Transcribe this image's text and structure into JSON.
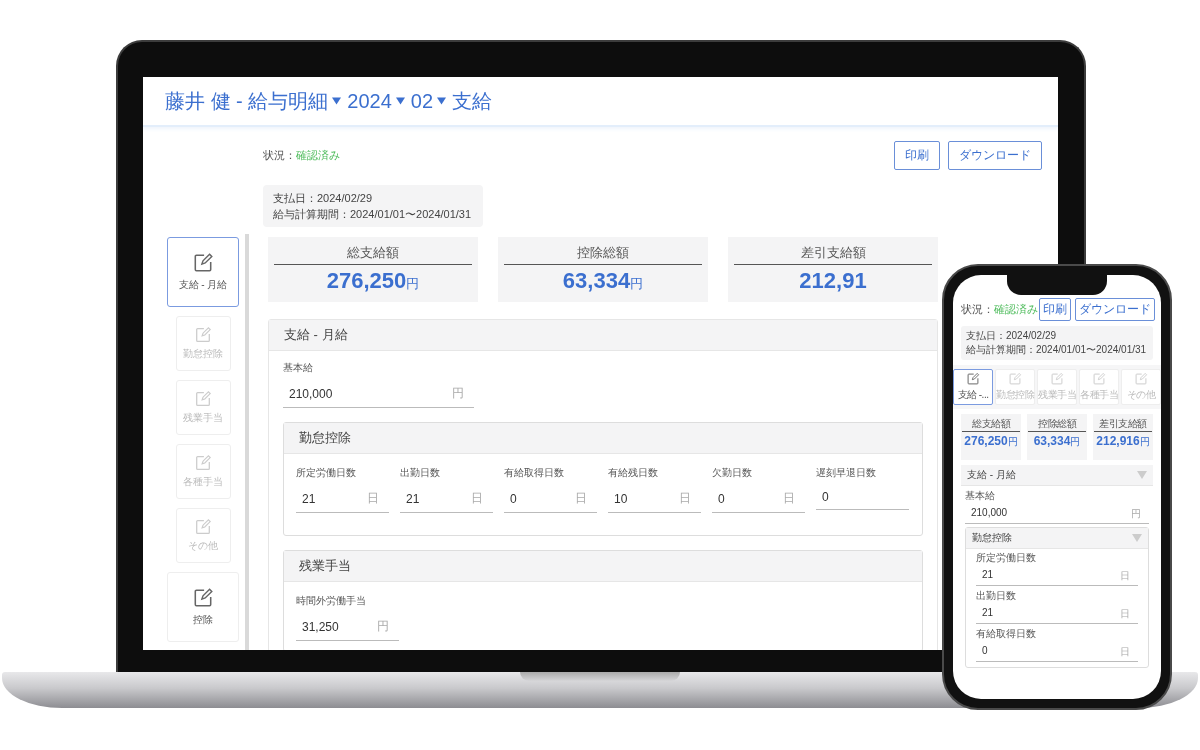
{
  "laptop": {
    "title": [
      {
        "text": "藤井 健 - 給与明細",
        "dropdown": true
      },
      {
        "text": "2024",
        "dropdown": true
      },
      {
        "text": "02",
        "dropdown": true
      },
      {
        "text": "支給",
        "dropdown": false
      }
    ],
    "status": {
      "label": "状況：",
      "value": "確認済み"
    },
    "buttons": [
      "印刷",
      "ダウンロード"
    ],
    "pay_info": [
      "支払日：2024/02/29",
      "給与計算期間：2024/01/01〜2024/01/31"
    ],
    "sidebar": [
      {
        "label": "支給 - 月給",
        "kind": "main",
        "selected": true
      },
      {
        "label": "勤怠控除",
        "kind": "sub",
        "selected": false
      },
      {
        "label": "残業手当",
        "kind": "sub",
        "selected": false
      },
      {
        "label": "各種手当",
        "kind": "sub",
        "selected": false
      },
      {
        "label": "その他",
        "kind": "sub",
        "selected": false
      },
      {
        "label": "控除",
        "kind": "main",
        "selected": false
      }
    ],
    "summary": [
      {
        "label": "総支給額",
        "amount": "276,250",
        "unit": "円"
      },
      {
        "label": "控除総額",
        "amount": "63,334",
        "unit": "円"
      },
      {
        "label": "差引支給額",
        "amount": "212,91"
      }
    ],
    "section": {
      "title": "支給 - 月給",
      "fields": [
        {
          "label": "基本給",
          "value": "210,000",
          "unit": "円"
        }
      ],
      "subsections": [
        {
          "title": "勤怠控除",
          "fields": [
            {
              "label": "所定労働日数",
              "value": "21",
              "unit": "日"
            },
            {
              "label": "出勤日数",
              "value": "21",
              "unit": "日"
            },
            {
              "label": "有給取得日数",
              "value": "0",
              "unit": "日"
            },
            {
              "label": "有給残日数",
              "value": "10",
              "unit": "日"
            },
            {
              "label": "欠勤日数",
              "value": "0",
              "unit": "日"
            },
            {
              "label": "遅刻早退日数",
              "value": "0"
            }
          ]
        },
        {
          "title": "残業手当",
          "fields": [
            {
              "label": "時間外労働手当",
              "value": "31,250",
              "unit": "円"
            }
          ]
        }
      ]
    }
  },
  "phone": {
    "status": {
      "label": "状況：",
      "value": "確認済み"
    },
    "buttons": [
      "印刷",
      "ダウンロード"
    ],
    "pay_info": [
      "支払日：2024/02/29",
      "給与計算期間：2024/01/01〜2024/01/31"
    ],
    "tabs": [
      {
        "label": "支給 -...",
        "selected": true
      },
      {
        "label": "勤怠控除",
        "selected": false
      },
      {
        "label": "残業手当",
        "selected": false
      },
      {
        "label": "各種手当",
        "selected": false
      },
      {
        "label": "その他",
        "selected": false
      }
    ],
    "summary": [
      {
        "label": "総支給額",
        "amount": "276,250",
        "unit": "円"
      },
      {
        "label": "控除総額",
        "amount": "63,334",
        "unit": "円"
      },
      {
        "label": "差引支給額",
        "amount": "212,916",
        "unit": "円"
      }
    ],
    "section": {
      "title": "支給 - 月給",
      "caret": true,
      "fields": [
        {
          "label": "基本給",
          "value": "210,000",
          "unit": "円"
        }
      ],
      "subsections": [
        {
          "title": "勤怠控除",
          "caret": true,
          "fields": [
            {
              "label": "所定労働日数",
              "value": "21",
              "unit": "日"
            },
            {
              "label": "出勤日数",
              "value": "21",
              "unit": "日"
            },
            {
              "label": "有給取得日数",
              "value": "0",
              "unit": "日"
            }
          ]
        }
      ]
    }
  }
}
